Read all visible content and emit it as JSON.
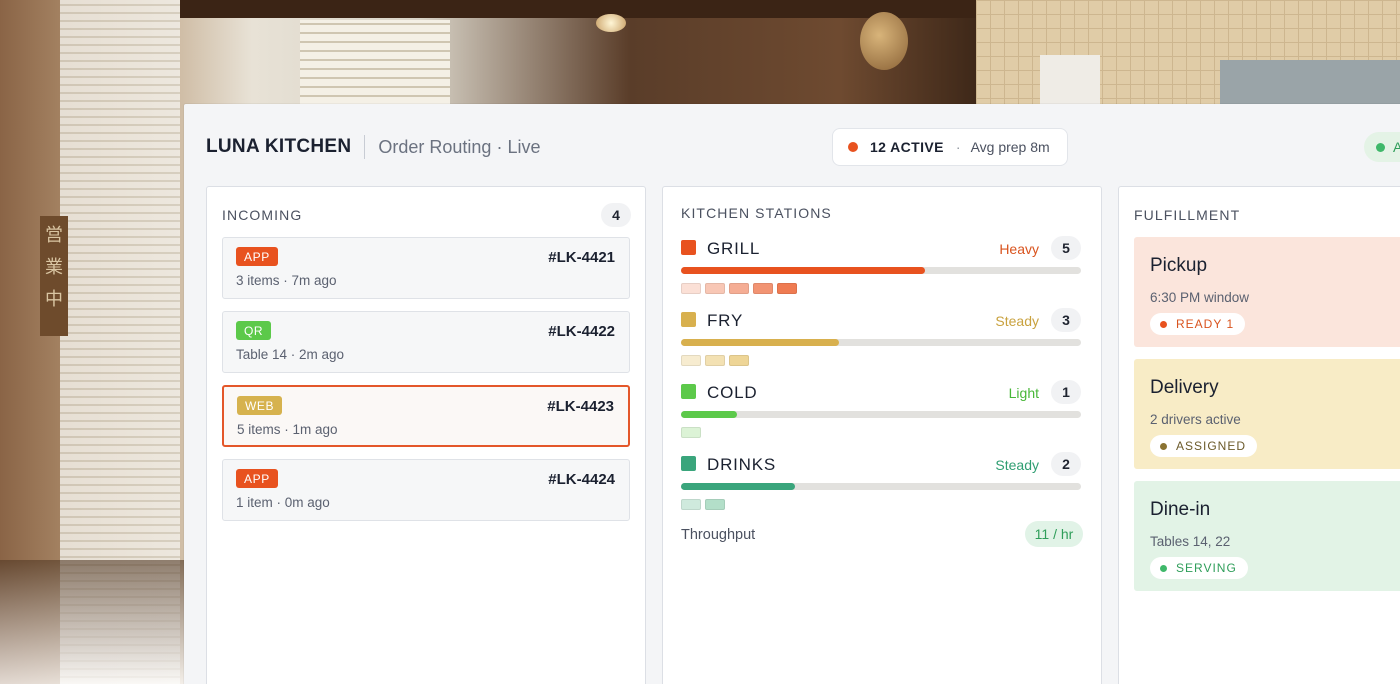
{
  "header": {
    "brand": "LUNA KITCHEN",
    "subtitle": "Order Routing · Live",
    "active_count": "12 ACTIVE",
    "separator": "·",
    "avg_prep": "Avg prep 8m",
    "status_text": "A"
  },
  "background": {
    "sign_text": [
      "営",
      "業",
      "中"
    ]
  },
  "incoming": {
    "title": "INCOMING",
    "count": "4",
    "orders": [
      {
        "channel": "APP",
        "channel_color": "#e8521f",
        "id": "#LK-4421",
        "meta": "3 items · 7m ago",
        "selected": false
      },
      {
        "channel": "QR",
        "channel_color": "#5cc94a",
        "id": "#LK-4422",
        "meta": "Table 14 · 2m ago",
        "selected": false
      },
      {
        "channel": "WEB",
        "channel_color": "#d6b24e",
        "id": "#LK-4423",
        "meta": "5 items · 1m ago",
        "selected": true
      },
      {
        "channel": "APP",
        "channel_color": "#e8521f",
        "id": "#LK-4424",
        "meta": "1 item · 0m ago",
        "selected": false
      }
    ]
  },
  "stations": {
    "title": "KITCHEN STATIONS",
    "items": [
      {
        "name": "GRILL",
        "level": "Heavy",
        "count": "5",
        "load": 0.61,
        "color": "#e8521f",
        "level_color": "#d9541f",
        "chip_colors": [
          "#fbe0d6",
          "#f8c7b5",
          "#f5ad94",
          "#f29473",
          "#ef7b52"
        ]
      },
      {
        "name": "FRY",
        "level": "Steady",
        "count": "3",
        "load": 0.395,
        "color": "#d8b04e",
        "level_color": "#c9a23f",
        "chip_colors": [
          "#f7ecd0",
          "#f3e1b3",
          "#eed596"
        ]
      },
      {
        "name": "COLD",
        "level": "Light",
        "count": "1",
        "load": 0.14,
        "color": "#5cc94a",
        "level_color": "#48b738",
        "chip_colors": [
          "#dcf3d6"
        ]
      },
      {
        "name": "DRINKS",
        "level": "Steady",
        "count": "2",
        "load": 0.285,
        "color": "#3aa57c",
        "level_color": "#2f9e72",
        "chip_colors": [
          "#cfeadd",
          "#b3dfc9"
        ]
      }
    ],
    "throughput_label": "Throughput",
    "throughput_value": "11 / hr"
  },
  "fulfillment": {
    "title": "FULFILLMENT",
    "cards": [
      {
        "title": "Pickup",
        "sub": "6:30 PM window",
        "badge": "READY 1",
        "bg": "#fbe5dc",
        "badge_color": "#d9541f",
        "dot_color": "#e8521f"
      },
      {
        "title": "Delivery",
        "sub": "2 drivers active",
        "badge": "ASSIGNED",
        "bg": "#f8ecc6",
        "badge_color": "#6b5a2a",
        "dot_color": "#8a7232"
      },
      {
        "title": "Dine-in",
        "sub": "Tables 14, 22",
        "badge": "SERVING",
        "bg": "#e2f3e6",
        "badge_color": "#2f9e5a",
        "dot_color": "#3fb86a"
      }
    ]
  }
}
